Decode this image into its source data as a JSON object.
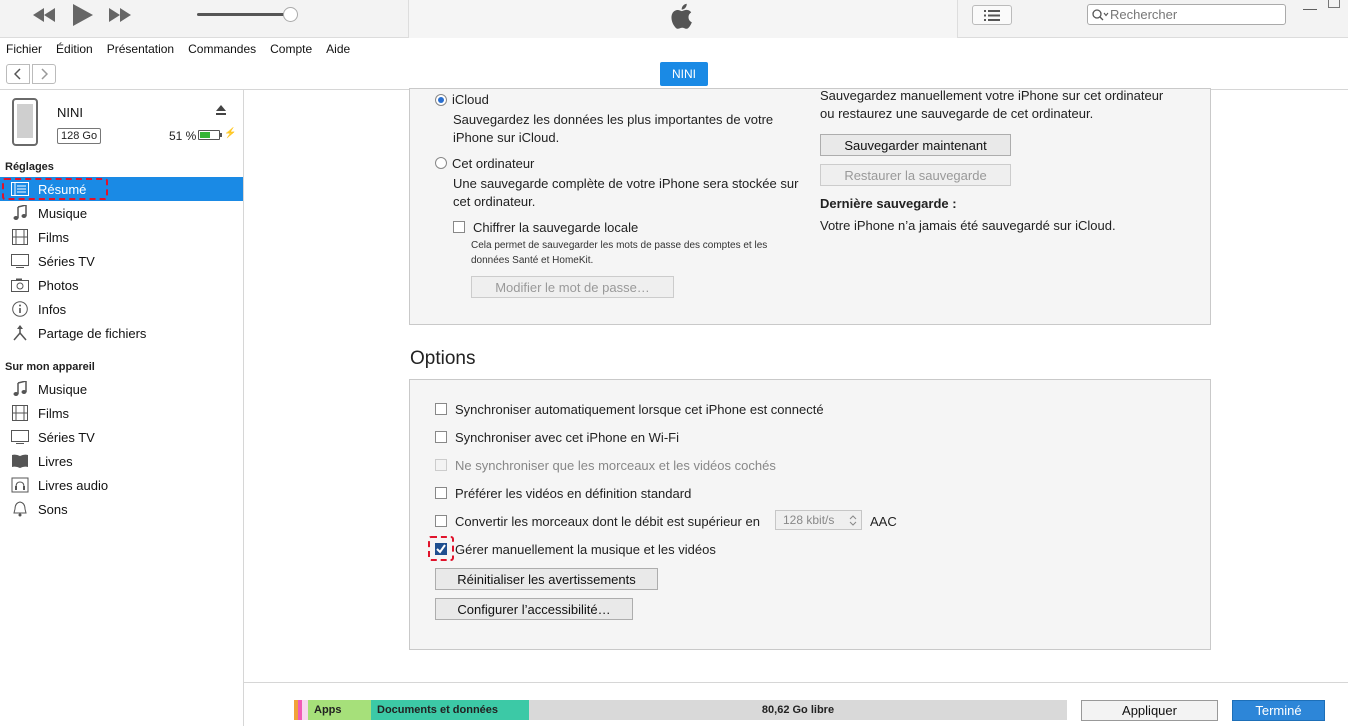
{
  "player": {
    "search_placeholder": "Rechercher"
  },
  "menu": [
    "Fichier",
    "Édition",
    "Présentation",
    "Commandes",
    "Compte",
    "Aide"
  ],
  "device_pill": "NINI",
  "device": {
    "name": "NINI",
    "capacity": "128 Go",
    "battery": "51 %",
    "battery_level": 0.51
  },
  "sidebar": {
    "settings_title": "Réglages",
    "settings_items": [
      "Résumé",
      "Musique",
      "Films",
      "Séries TV",
      "Photos",
      "Infos",
      "Partage de fichiers"
    ],
    "device_title": "Sur mon appareil",
    "device_items": [
      "Musique",
      "Films",
      "Séries TV",
      "Livres",
      "Livres audio",
      "Sons"
    ]
  },
  "backup": {
    "icloud_label": "iCloud",
    "icloud_desc_1": "Sauvegardez les données les plus importantes de votre",
    "icloud_desc_2": "iPhone sur iCloud.",
    "computer_label": "Cet ordinateur",
    "computer_desc_1": "Une sauvegarde complète de votre iPhone sera stockée sur",
    "computer_desc_2": "cet ordinateur.",
    "encrypt_label": "Chiffrer la sauvegarde locale",
    "encrypt_desc_1": "Cela permet de sauvegarder les mots de passe des comptes et les",
    "encrypt_desc_2": "données Santé et HomeKit.",
    "change_pw_button": "Modifier le mot de passe…",
    "manual_desc_1": "Sauvegardez manuellement votre iPhone sur cet ordinateur",
    "manual_desc_2": "ou restaurez une sauvegarde de cet ordinateur.",
    "backup_now_button": "Sauvegarder maintenant",
    "restore_button": "Restaurer la sauvegarde",
    "last_backup_title": "Dernière sauvegarde :",
    "last_backup_text": "Votre iPhone n’a jamais été sauvegardé sur iCloud."
  },
  "options": {
    "title": "Options",
    "opt1": "Synchroniser automatiquement lorsque cet iPhone est connecté",
    "opt2": "Synchroniser avec cet iPhone en Wi-Fi",
    "opt3": "Ne synchroniser que les morceaux et les vidéos cochés",
    "opt4": "Préférer les vidéos en définition standard",
    "opt5": "Convertir les morceaux dont le débit est supérieur en",
    "bitrate": "128 kbit/s",
    "codec": "AAC",
    "opt6": "Gérer manuellement la musique et les vidéos",
    "reset_button": "Réinitialiser les avertissements",
    "accessibility_button": "Configurer l’accessibilité…"
  },
  "footer": {
    "apps_label": "Apps",
    "docs_label": "Documents et données",
    "free_label": "80,62 Go libre",
    "apply_button": "Appliquer",
    "done_button": "Terminé"
  },
  "colors": {
    "accent": "#1a8ae5",
    "apps": "#a6e07a",
    "docs": "#3cc9a6",
    "highlight": "#e0132b"
  }
}
